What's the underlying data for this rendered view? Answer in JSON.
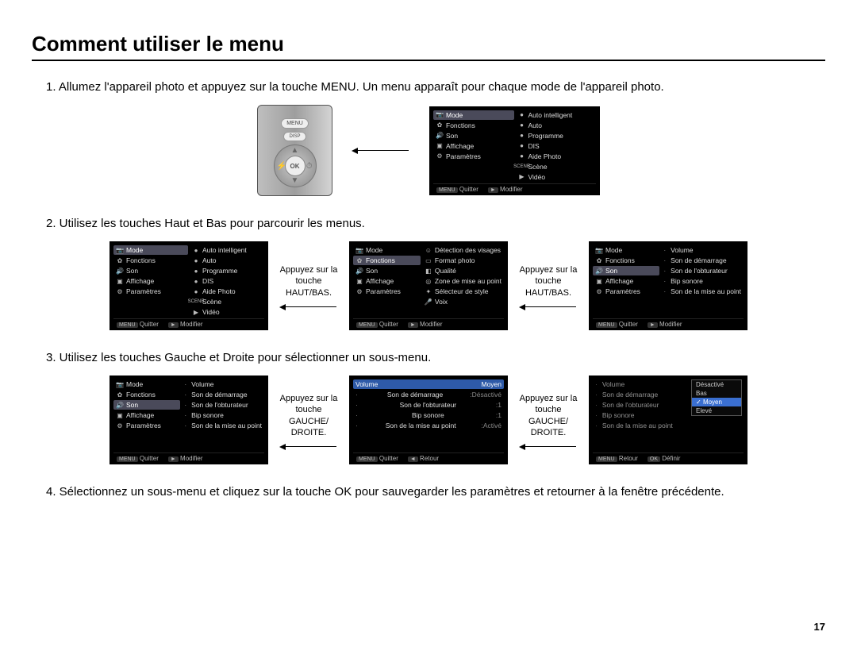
{
  "title": "Comment utiliser le menu",
  "page_number": "17",
  "steps": {
    "s1": "1. Allumez l'appareil photo et appuyez sur la touche MENU.  Un menu apparaît pour chaque mode de l'appareil photo.",
    "s2": "2. Utilisez les touches Haut et Bas pour parcourir les menus.",
    "s3": "3. Utilisez les touches Gauche et Droite pour sélectionner un sous-menu.",
    "s4": "4. Sélectionnez un sous-menu et cliquez sur la touche OK pour sauvegarder les paramètres et retourner à la fenêtre précédente."
  },
  "captions": {
    "updown": "Appuyez sur la touche HAUT/BAS.",
    "leftright": "Appuyez sur la touche GAUCHE/ DROITE."
  },
  "camera": {
    "menu": "MENU",
    "disp": "DISP",
    "ok": "OK"
  },
  "left_menu": {
    "mode": "Mode",
    "fonctions": "Fonctions",
    "son": "Son",
    "affichage": "Affichage",
    "parametres": "Paramètres"
  },
  "modes": {
    "auto_int": "Auto intelligent",
    "auto": "Auto",
    "programme": "Programme",
    "dis": "DIS",
    "aide": "Aide Photo",
    "scene": "Scène",
    "video": "Vidéo"
  },
  "fonctions_sub": {
    "detection": "Détection des visages",
    "format": "Format photo",
    "qualite": "Qualité",
    "zone": "Zone de mise au point",
    "style": "Sélecteur de style",
    "voix": "Voix"
  },
  "son_sub": {
    "volume": "Volume",
    "dem": "Son de démarrage",
    "obt": "Son de l'obturateur",
    "bip": "Bip sonore",
    "map": "Son de la mise au point"
  },
  "son_values": {
    "volume": "Moyen",
    "dem": "Désactivé",
    "obt": "1",
    "bip": "1",
    "map": "Activé"
  },
  "volume_options": {
    "o1": "Désactivé",
    "o2": "Bas",
    "o3": "Moyen",
    "o4": "Elevé"
  },
  "footer": {
    "menu": "MENU",
    "quitter": "Quitter",
    "modifier": "Modifier",
    "retour": "Retour",
    "definir": "Définir",
    "ok": "OK",
    "play": "►",
    "back": "◄"
  },
  "scene_label": "SCENE"
}
